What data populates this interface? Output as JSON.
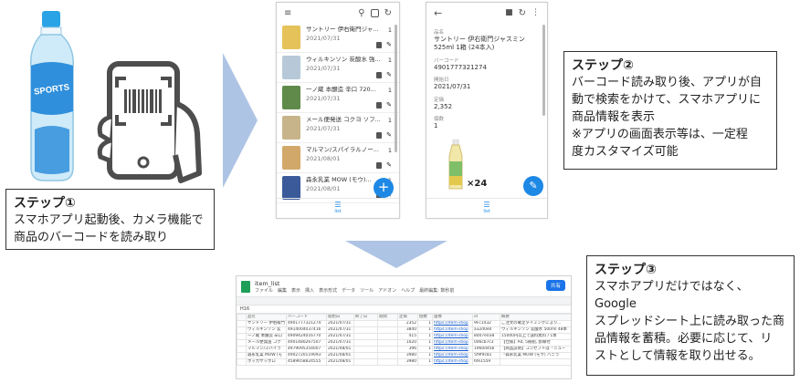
{
  "steps": [
    {
      "title": "ステップ①",
      "lines": [
        "スマホアプリ起動後、カメラ機能で",
        "商品のバーコードを読み取り"
      ]
    },
    {
      "title": "ステップ②",
      "lines": [
        "バーコード読み取り後、アプリが自",
        "動で検索をかけて、スマホアプリに",
        "商品情報を表示",
        "※アプリの画面表示等は、一定程",
        "度カスタマイズ可能"
      ]
    },
    {
      "title": "ステップ③",
      "lines": [
        "スマホアプリだけではなく、Google",
        "スプレッドシート上に読み取った商",
        "品情報を蓄積。必要に応じて、リ",
        "ストとして情報を取り出せる。"
      ]
    }
  ],
  "bottle_label": "SPORTS",
  "app_list": {
    "items": [
      {
        "name": "サントリー 伊右衛門ジャ...",
        "date": "2021/07/31",
        "count": "1",
        "color": "#e6c25a"
      },
      {
        "name": "ウィルキンソン 炭酸水 強...",
        "date": "2021/07/31",
        "count": "1",
        "color": "#b7c9d9"
      },
      {
        "name": "一ノ蔵 本醸造 辛口 720...",
        "date": "2021/07/31",
        "count": "1",
        "color": "#5f8a4a"
      },
      {
        "name": "メール便発送 コクヨ ソフ...",
        "date": "2021/07/31",
        "count": "1",
        "color": "#c8b48a"
      },
      {
        "name": "マルマン/スパイラルノー...",
        "date": "2021/08/01",
        "count": "1",
        "color": "#d2a86a"
      },
      {
        "name": "森永乳業 MOW (モウ)...",
        "date": "2021/08/01",
        "count": "1",
        "color": "#3a5a9a"
      }
    ],
    "tab_label": "list"
  },
  "app_detail": {
    "name_label": "品名",
    "name": "サントリー 伊右衛門ジャスミン 525ml 1箱 (24本入)",
    "barcode_label": "バーコード",
    "barcode": "4901777321274",
    "date_label": "開始日",
    "date": "2021/07/31",
    "price_label": "定価",
    "price": "2,352",
    "qty_label": "個数",
    "qty": "1",
    "multiplier": "×24",
    "tab_label": "list"
  },
  "sheet": {
    "title": "item_list",
    "menu": [
      "ファイル",
      "編集",
      "表示",
      "挿入",
      "表示形式",
      "データ",
      "ツール",
      "アドオン",
      "ヘルプ",
      "最終編集: 数秒前"
    ],
    "share_label": "共有",
    "cell_ref": "H16",
    "headers": [
      "品名",
      "バーコード",
      "開始日",
      "終了日",
      "期間",
      "定価",
      "個数",
      "画像",
      "id",
      "概要"
    ],
    "rows": [
      [
        "サントリー 伊右衛門",
        "4901777321274",
        "2021/07/31",
        "",
        "",
        "2352",
        "1",
        "https://item-shop",
        "9Fc1432",
        "ご注文の確定タイミングにより..."
      ],
      [
        "ウィルキンソン 炭",
        "4914004037416",
        "2021/07/31",
        "",
        "",
        "3840",
        "1",
        "https://item-shop",
        "a32d0e0",
        "ウィルキンソン 炭酸水 500ml 48本"
      ],
      [
        "一ノ蔵 本醸造 辛口",
        "4909424016770",
        "2021/07/31",
        "",
        "",
        "415",
        "1",
        "https://item-shop",
        "8d07e038",
        "15000円以上で送料無料 / 1本"
      ],
      [
        "メール便発送 コク",
        "4901480267507",
        "2021/07/31",
        "",
        "",
        "1020",
        "1",
        "https://item-shop",
        "0d6cb7c3",
        "【仕様】A4, 5冊組, 罫線付"
      ],
      [
        "マルマン/スパイラ",
        "4979095354007",
        "2021/08/01",
        "",
        "",
        "396",
        "1",
        "https://item-shop",
        "1960d45b",
        "【商品説明】コンセプトは「ニュー"
      ],
      [
        "森永乳業 MOW (モ",
        "4902720119093",
        "2021/08/01",
        "",
        "",
        "3980",
        "1",
        "https://item-shop",
        "5f9f9c81",
        "「森永乳業 MOW (モウ) バニラ"
      ],
      [
        "ポッカサッポロ",
        "4589658824555",
        "2021/08/01",
        "",
        "",
        "3980",
        "1",
        "https://item-shop",
        "6fe1559",
        ""
      ]
    ]
  }
}
